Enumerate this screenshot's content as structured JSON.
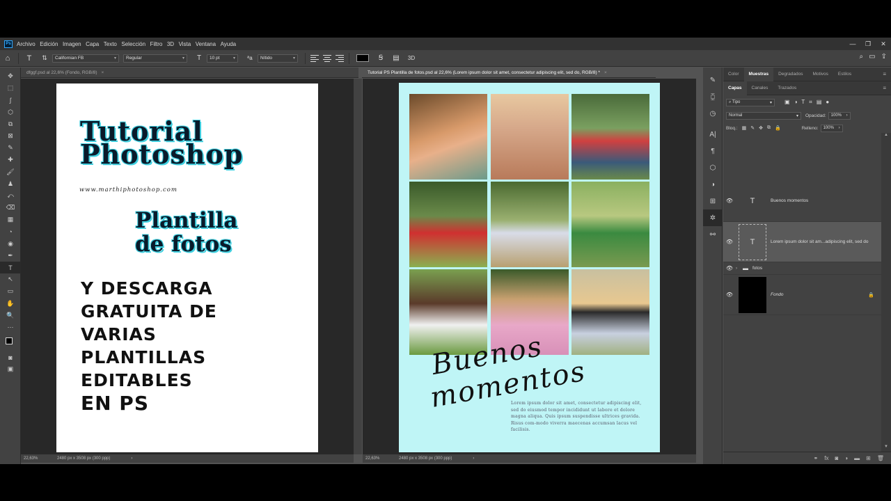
{
  "menubar": {
    "logo": "Ps",
    "items": [
      "Archivo",
      "Edición",
      "Imagen",
      "Capa",
      "Texto",
      "Selección",
      "Filtro",
      "3D",
      "Vista",
      "Ventana",
      "Ayuda"
    ],
    "window_controls": [
      "—",
      "❐",
      "✕"
    ]
  },
  "options_bar": {
    "tool_glyph": "T",
    "font_family": "Californian FB",
    "font_style": "Regular",
    "font_size": "10 pt",
    "antialias": "Nítido",
    "right_glyphs": [
      "⌕",
      "▭",
      "⇪"
    ]
  },
  "toolbox": {
    "tools": [
      "✥",
      "⬚",
      "ʃ",
      "⬡",
      "⧉",
      "⊠",
      "✎",
      "✚",
      "🖌",
      "♟",
      "⤺",
      "⌫",
      "▦",
      "◔",
      "◉",
      "✒",
      "T",
      "↖",
      "▭",
      "✋",
      "🔍",
      "⋯"
    ]
  },
  "doc_left": {
    "tab": "dfggf.psd al 22,6% (Fondo, RGB/8)",
    "title_line1": "Tutorial",
    "title_line2": "Photoshop",
    "url": "www.marthiphotoshop.com",
    "sub_line1": "Plantilla",
    "sub_line2": "de fotos",
    "body_lines": [
      "Y DESCARGA",
      "GRATUITA DE",
      "VARIAS",
      "PLANTILLAS",
      "EDITABLES",
      "EN PS"
    ],
    "zoom": "22,63%",
    "doc_size": "2480 px x 3508 px (300 ppp)"
  },
  "doc_right": {
    "tab": "Tutorial PS Plantilla de fotos.psd al 22,6% (Lorem ipsum dolor sit amet, consectetur adipiscing elit, sed do, RGB/8) *",
    "script_line1": "Buenos",
    "script_line2": "momentos",
    "lorem": "Lorem ipsum dolor sit amet, consectetur adipiscing elit, sed do eiusmod tempor incididunt ut labore et dolore magna aliqua. Quis ipsum suspendisse ultrices gravida. Risus com-modo viverra maecenas accumsan lacus vel facilisis.",
    "zoom": "22,63%",
    "doc_size": "2480 px x 3508 px (300 ppp)"
  },
  "panels": {
    "top_tabs": [
      "Color",
      "Muestras",
      "Degradados",
      "Motivos",
      "Estilos"
    ],
    "active_top_tab": "Muestras",
    "layer_tabs": [
      "Capas",
      "Canales",
      "Trazados"
    ],
    "active_layer_tab": "Capas",
    "filter_kind": "Tipo",
    "blend_mode": "Normal",
    "opacity_label": "Opacidad:",
    "opacity_value": "100%",
    "lock_label": "Bloq.:",
    "fill_label": "Relleno:",
    "fill_value": "100%",
    "layers": [
      {
        "name": "Buenos momentos",
        "kind": "text"
      },
      {
        "name": "Lorem ipsum dolor sit am...adipiscing elit, sed do",
        "kind": "text",
        "selected": true
      },
      {
        "name": "fotos",
        "kind": "group"
      },
      {
        "name": "Fondo",
        "kind": "background",
        "locked": true
      }
    ]
  },
  "colors": {
    "title_outline": "#40d0e0",
    "template_bg": "#bff5f6"
  }
}
